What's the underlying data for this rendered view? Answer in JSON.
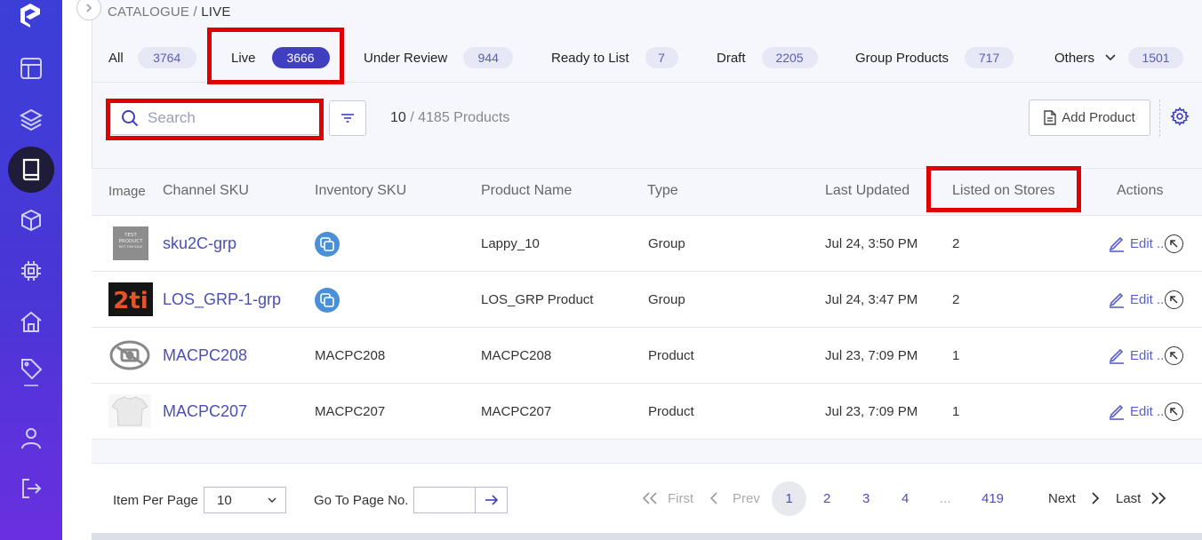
{
  "breadcrumb": {
    "parent": "CATALOGUE",
    "sep": " / ",
    "current": "LIVE"
  },
  "tabs": [
    {
      "label": "All",
      "count": "3764"
    },
    {
      "label": "Live",
      "count": "3666"
    },
    {
      "label": "Under Review",
      "count": "944"
    },
    {
      "label": "Ready to List",
      "count": "7"
    },
    {
      "label": "Draft",
      "count": "2205"
    },
    {
      "label": "Group Products",
      "count": "717"
    },
    {
      "label": "Others",
      "count": "1501"
    }
  ],
  "toolbar": {
    "search_placeholder": "Search",
    "count_shown": "10",
    "count_total": " / 4185 Products",
    "add_label": "Add Product"
  },
  "table": {
    "headers": [
      "Image",
      "Channel SKU",
      "Inventory SKU",
      "Product Name",
      "Type",
      "Last Updated",
      "Listed on Stores",
      "Actions"
    ],
    "rows": [
      {
        "sku": "sku2C-grp",
        "inventory_sku": "",
        "name": "Lappy_10",
        "type": "Group",
        "updated": "Jul 24, 3:50 PM",
        "stores": "2",
        "edit": "Edit .."
      },
      {
        "sku": "LOS_GRP-1-grp",
        "inventory_sku": "",
        "name": "LOS_GRP Product",
        "type": "Group",
        "updated": "Jul 24, 3:47 PM",
        "stores": "2",
        "edit": "Edit .."
      },
      {
        "sku": "MACPC208",
        "inventory_sku": "MACPC208",
        "name": "MACPC208",
        "type": "Product",
        "updated": "Jul 23, 7:09 PM",
        "stores": "1",
        "edit": "Edit .."
      },
      {
        "sku": "MACPC207",
        "inventory_sku": "MACPC207",
        "name": "MACPC207",
        "type": "Product",
        "updated": "Jul 23, 7:09 PM",
        "stores": "1",
        "edit": "Edit .."
      }
    ],
    "thumb_text": {
      "line1": "TEST",
      "line2": "PRODUCT",
      "line3": "NOT FOR SALE",
      "logo2": "2ti"
    }
  },
  "footer": {
    "items_label": "Item Per Page",
    "items_value": "10",
    "goto_label": "Go To Page No.",
    "first": "First",
    "prev": "Prev",
    "pages": [
      "1",
      "2",
      "3",
      "4",
      "...",
      "419"
    ],
    "next": "Next",
    "last": "Last"
  },
  "colors": {
    "sidebar": "#4a36d6",
    "accent": "#3f3fbf",
    "link": "#4a4fb8",
    "highlight": "#e00000"
  }
}
